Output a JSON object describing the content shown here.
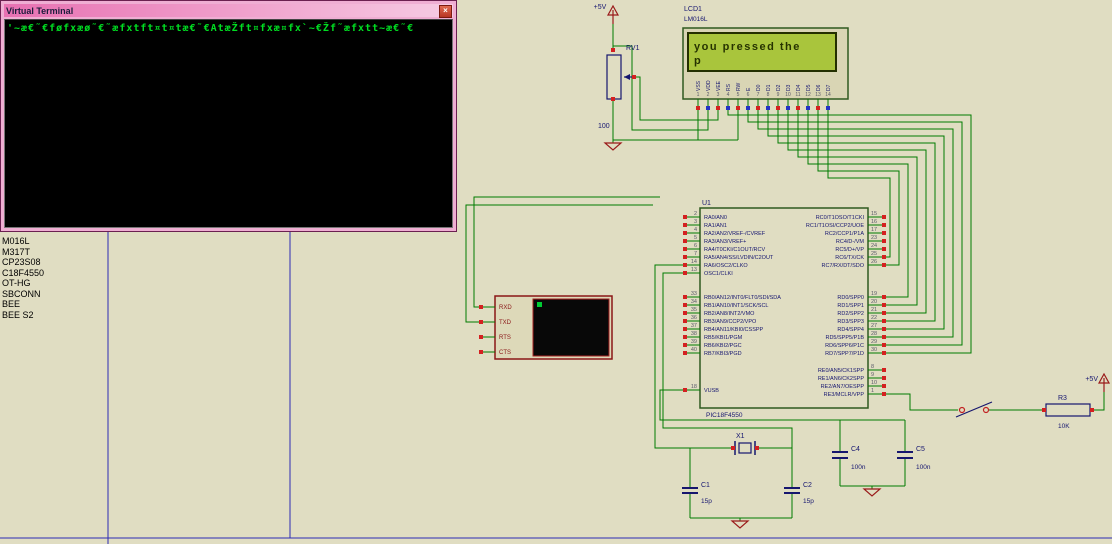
{
  "window": {
    "title": "Virtual Terminal",
    "close_glyph": "×",
    "terminal_text": "'~æ€˜€føfxæø˜€˜æfxtft¤t¤tæ€˜€AtæŽft¤fxæ¤fx`~€Žf˜æfxtt~æ€˜€"
  },
  "component_list": {
    "items": [
      "M016L",
      "M317T",
      "CP23S08",
      "C18F4550",
      "OT-HG",
      "SBCONN",
      "BEE",
      "BEE S2"
    ]
  },
  "power": {
    "vcc": "+5V"
  },
  "parts": {
    "rv1": {
      "ref": "RV1",
      "value": "100"
    },
    "lcd": {
      "ref": "LCD1",
      "part": "LM016L",
      "screen_line1": "you pressed the",
      "screen_line2": "p",
      "pin_numbers": [
        "1",
        "2",
        "3",
        "4",
        "5",
        "6",
        "7",
        "8",
        "9",
        "10",
        "11",
        "12",
        "13",
        "14"
      ],
      "pin_names": [
        "VSS",
        "VDD",
        "VEE",
        "RS",
        "RW",
        "E",
        "D0",
        "D1",
        "D2",
        "D3",
        "D4",
        "D5",
        "D6",
        "D7"
      ]
    },
    "u1": {
      "ref": "U1",
      "part": "PIC18F4550",
      "left_groups": [
        {
          "pins": [
            [
              "2",
              "RA0/AN0"
            ],
            [
              "3",
              "RA1/AN1"
            ],
            [
              "4",
              "RA2/AN2/VREF-/CVREF"
            ],
            [
              "5",
              "RA3/AN3/VREF+"
            ],
            [
              "6",
              "RA4/T0CKI/C1OUT/RCV"
            ],
            [
              "7",
              "RA5/AN4/SS/LVDIN/C2OUT"
            ],
            [
              "14",
              "RA6/OSC2/CLKO"
            ],
            [
              "13",
              "OSC1/CLKI"
            ]
          ]
        },
        {
          "pins": [
            [
              "33",
              "RB0/AN12/INT0/FLT0/SDI/SDA"
            ],
            [
              "34",
              "RB1/AN10/INT1/SCK/SCL"
            ],
            [
              "35",
              "RB2/AN8/INT2/VMO"
            ],
            [
              "36",
              "RB3/AN9/CCP2/VPO"
            ],
            [
              "37",
              "RB4/AN11/KBI0/CSSPP"
            ],
            [
              "38",
              "RB5/KBI1/PGM"
            ],
            [
              "39",
              "RB6/KBI2/PGC"
            ],
            [
              "40",
              "RB7/KBI3/PGD"
            ]
          ]
        },
        {
          "pins": [
            [
              "18",
              "VUSB"
            ]
          ]
        }
      ],
      "right_groups": [
        {
          "pins": [
            [
              "15",
              "RC0/T1OSO/T1CKI"
            ],
            [
              "16",
              "RC1/T1OSI/CCP2/UOE"
            ],
            [
              "17",
              "RC2/CCP1/P1A"
            ],
            [
              "23",
              "RC4/D-/VM"
            ],
            [
              "24",
              "RC5/D+/VP"
            ],
            [
              "25",
              "RC6/TX/CK"
            ],
            [
              "26",
              "RC7/RX/DT/SDO"
            ]
          ]
        },
        {
          "pins": [
            [
              "19",
              "RD0/SPP0"
            ],
            [
              "20",
              "RD1/SPP1"
            ],
            [
              "21",
              "RD2/SPP2"
            ],
            [
              "22",
              "RD3/SPP3"
            ],
            [
              "27",
              "RD4/SPP4"
            ],
            [
              "28",
              "RD5/SPP5/P1B"
            ],
            [
              "29",
              "RD6/SPP6/P1C"
            ],
            [
              "30",
              "RD7/SPP7/P1D"
            ]
          ]
        },
        {
          "pins": [
            [
              "8",
              "RE0/AN5/CK1SPP"
            ],
            [
              "9",
              "RE1/AN6/CK2SPP"
            ],
            [
              "10",
              "RE2/AN7/OESPP"
            ],
            [
              "1",
              "RE3/MCLR/VPP"
            ]
          ]
        }
      ]
    },
    "vterm": {
      "pins": [
        "RXD",
        "TXD",
        "RTS",
        "CTS"
      ]
    },
    "x1": {
      "ref": "X1"
    },
    "c1": {
      "ref": "C1",
      "value": "15p"
    },
    "c2": {
      "ref": "C2",
      "value": "15p"
    },
    "c4": {
      "ref": "C4",
      "value": "100n"
    },
    "c5": {
      "ref": "C5",
      "value": "100n"
    },
    "r3": {
      "ref": "R3",
      "value": "10K"
    }
  },
  "colors": {
    "wire": "#007a00",
    "background": "#e0ddc2",
    "lcd_screen": "#a9c53c",
    "terminal_green": "#00dd22",
    "titlebar_pink": "#e871b2"
  }
}
